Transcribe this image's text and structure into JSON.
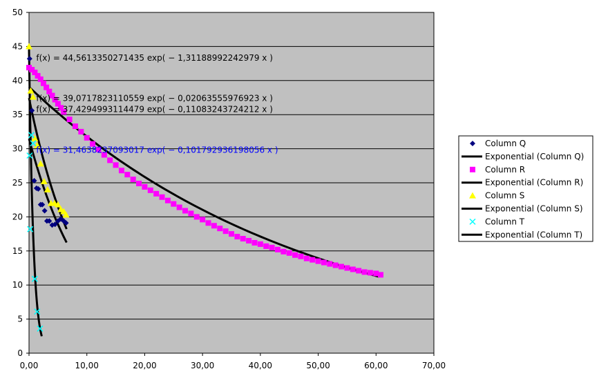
{
  "chart_data": {
    "type": "scatter",
    "title": "",
    "xlabel": "",
    "ylabel": "",
    "xlim": [
      0,
      70
    ],
    "ylim": [
      0,
      50
    ],
    "x_ticks": [
      "0,00",
      "10,00",
      "20,00",
      "30,00",
      "40,00",
      "50,00",
      "60,00",
      "70,00"
    ],
    "y_ticks": [
      "0",
      "5",
      "10",
      "15",
      "20",
      "25",
      "30",
      "35",
      "40",
      "45",
      "50"
    ],
    "grid": "horizontal",
    "plot_background": "#c0c0c0",
    "legend_position": "right",
    "series": [
      {
        "name": "Column Q",
        "marker": "diamond",
        "color": "#000080",
        "x": [
          0.1,
          0.5,
          0.9,
          1.3,
          1.6,
          2.0,
          2.3,
          2.7,
          3.1,
          3.5,
          4.0,
          4.5,
          5.0,
          5.5,
          6.0,
          6.4
        ],
        "y": [
          43.2,
          35.6,
          25.3,
          24.2,
          24.1,
          21.8,
          21.8,
          20.9,
          19.4,
          19.4,
          18.8,
          18.9,
          19.4,
          19.7,
          19.4,
          19.1
        ]
      },
      {
        "name": "Column R",
        "marker": "square",
        "color": "#ff00ff",
        "x": [
          0.0,
          0.5,
          1.0,
          1.5,
          2.0,
          2.5,
          3.0,
          3.5,
          4.0,
          4.5,
          5.0,
          5.5,
          6.0,
          7.0,
          8.0,
          9.0,
          10.0,
          11.0,
          12.0,
          13.0,
          14.0,
          15.0,
          16.0,
          17.0,
          18.0,
          19.0,
          20.0,
          21.0,
          22.0,
          23.0,
          24.0,
          25.0,
          26.0,
          27.0,
          28.0,
          29.0,
          30.0,
          31.0,
          32.0,
          33.0,
          34.0,
          35.0,
          36.0,
          37.0,
          38.0,
          39.0,
          40.0,
          41.0,
          42.0,
          43.0,
          44.0,
          45.0,
          46.0,
          47.0,
          48.0,
          49.0,
          50.0,
          51.0,
          52.0,
          53.0,
          54.0,
          55.0,
          56.0,
          57.0,
          58.0,
          59.0,
          60.0,
          60.8
        ],
        "y": [
          41.9,
          41.6,
          41.2,
          40.7,
          40.2,
          39.6,
          39.0,
          38.4,
          37.8,
          37.2,
          36.6,
          36.0,
          35.4,
          34.3,
          33.3,
          32.5,
          31.6,
          30.7,
          29.9,
          29.1,
          28.3,
          27.6,
          26.8,
          26.2,
          25.5,
          24.9,
          24.4,
          23.9,
          23.4,
          22.9,
          22.4,
          21.9,
          21.4,
          20.9,
          20.5,
          20.0,
          19.6,
          19.1,
          18.7,
          18.3,
          17.9,
          17.5,
          17.1,
          16.8,
          16.5,
          16.2,
          16.0,
          15.7,
          15.5,
          15.2,
          14.9,
          14.7,
          14.4,
          14.2,
          13.9,
          13.7,
          13.5,
          13.3,
          13.1,
          12.9,
          12.7,
          12.5,
          12.3,
          12.1,
          11.9,
          11.8,
          11.7,
          11.5
        ]
      },
      {
        "name": "Column S",
        "marker": "triangle",
        "color": "#ffff00",
        "x": [
          0.0,
          0.3,
          0.7,
          1.0,
          1.4,
          2.0,
          2.6,
          3.2,
          3.8,
          4.4,
          5.0,
          5.5,
          6.0,
          6.4
        ],
        "y": [
          45.0,
          38.5,
          37.6,
          31.5,
          30.5,
          27.8,
          25.2,
          24.0,
          22.0,
          22.0,
          21.8,
          21.1,
          20.8,
          20.3
        ]
      },
      {
        "name": "Column T",
        "marker": "cross",
        "color": "#00ffff",
        "x": [
          0.1,
          0.2,
          0.4,
          0.7,
          1.0,
          1.4,
          1.9
        ],
        "y": [
          29.0,
          18.2,
          32.0,
          30.8,
          10.9,
          6.1,
          3.6
        ]
      }
    ],
    "trendlines": [
      {
        "name": "Exponential (Column Q)",
        "color": "#000000",
        "type": "exponential",
        "a": 31.4638,
        "b": -0.101793,
        "xrange": [
          0.0,
          6.5
        ]
      },
      {
        "name": "Exponential (Column R)",
        "color": "#000000",
        "type": "exponential",
        "a": 39.0718,
        "b": -0.0206356,
        "xrange": [
          0.0,
          60.5
        ]
      },
      {
        "name": "Exponential (Column S)",
        "color": "#000000",
        "type": "exponential",
        "a": 37.4295,
        "b": -0.110832,
        "xrange": [
          0.0,
          6.5
        ]
      },
      {
        "name": "Exponential (Column T)",
        "color": "#000000",
        "type": "exponential",
        "a": 44.5613,
        "b": -1.31189,
        "xrange": [
          0.0,
          2.2
        ]
      }
    ],
    "annotations": [
      {
        "text": "f(x) = 44,5613350271435 exp( − 1,31188992242979 x )",
        "color": "#000000",
        "x": 1.0,
        "y": 43.3
      },
      {
        "text": "f(x) = 39,0717823110559 exp( − 0,02063555976923 x )",
        "color": "#000000",
        "x": 1.0,
        "y": 37.4
      },
      {
        "text": "f(x) = 37,4294993114479 exp( − 0,11083243724212 x )",
        "color": "#000000",
        "x": 1.0,
        "y": 35.8
      },
      {
        "text": "f(x) = 31,4638237093017 exp( − 0,101792936198056 x )",
        "color": "#0000ff",
        "x": 1.0,
        "y": 29.8
      }
    ]
  }
}
